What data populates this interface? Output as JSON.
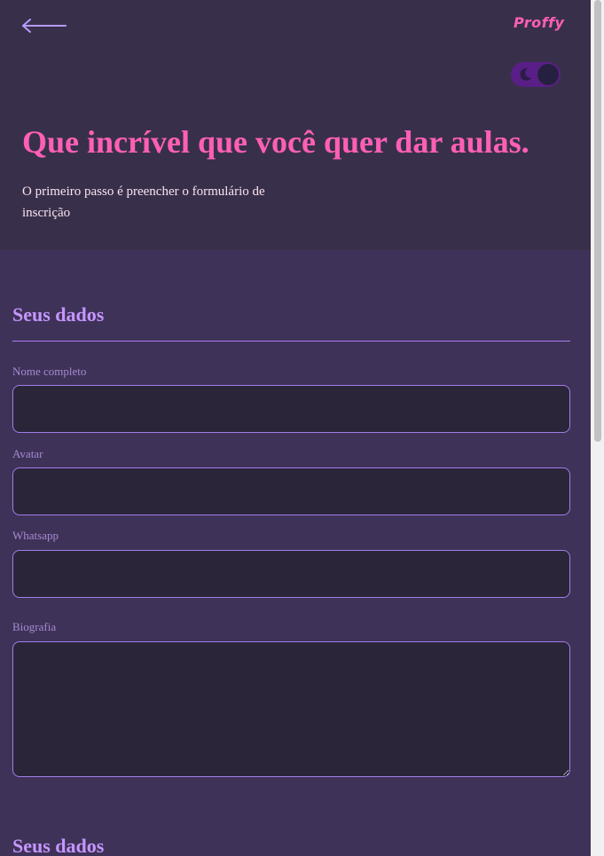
{
  "header": {
    "back_icon": "arrow-left-icon",
    "brand": "Proffy",
    "theme_toggle": {
      "icon": "moon-icon",
      "state": "dark"
    },
    "title": "Que incrível que você quer dar aulas.",
    "subtitle": "O primeiro passo é preencher o formulário de inscrição"
  },
  "form": {
    "sections": [
      {
        "title": "Seus dados",
        "fields": [
          {
            "label": "Nome completo",
            "value": "",
            "type": "text"
          },
          {
            "label": "Avatar",
            "value": "",
            "type": "text"
          },
          {
            "label": "Whatsapp",
            "value": "",
            "type": "text"
          },
          {
            "label": "Biografia",
            "value": "",
            "type": "textarea"
          }
        ]
      },
      {
        "title": "Seus dados"
      }
    ]
  },
  "colors": {
    "accent_pink": "#ff5fb4",
    "accent_purple": "#c596ff",
    "header_bg": "#38304a",
    "page_bg": "#3f3259",
    "input_bg": "#2b2539",
    "input_border": "#9f7ee8"
  }
}
